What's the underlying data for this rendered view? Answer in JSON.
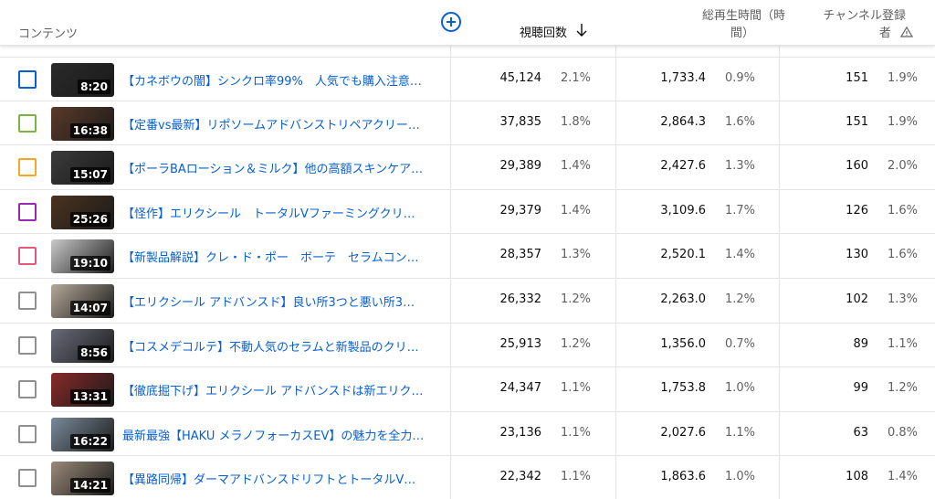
{
  "header": {
    "content_label": "コンテンツ",
    "views_label": "視聴回数",
    "watch_time_line1": "総再生時間（時",
    "watch_time_line2": "間）",
    "subs_line1": "チャンネル登録",
    "subs_line2": "者"
  },
  "colors": {
    "link": "#065fd4",
    "accent": "#065fd4"
  },
  "rows": [
    {
      "checkbox_color": "#065fd4",
      "duration": "8:20",
      "title": "【カネボウの闇】シンクロ率99%　人気でも購入注意…",
      "views": "45,124",
      "views_pct": "2.1%",
      "watch": "1,733.4",
      "watch_pct": "0.9%",
      "subs": "151",
      "subs_pct": "1.9%",
      "thumb_bg": "#2a2a2a"
    },
    {
      "checkbox_color": "#7cb342",
      "duration": "16:38",
      "title": "【定番vs最新】リポソームアドバンストリペアクリー…",
      "views": "37,835",
      "views_pct": "1.8%",
      "watch": "2,864.3",
      "watch_pct": "1.6%",
      "subs": "151",
      "subs_pct": "1.9%",
      "thumb_bg": "#5a3a2a"
    },
    {
      "checkbox_color": "#f5a623",
      "duration": "15:07",
      "title": "【ポーラBAローション＆ミルク】他の高額スキンケア…",
      "views": "29,389",
      "views_pct": "1.4%",
      "watch": "2,427.6",
      "watch_pct": "1.3%",
      "subs": "160",
      "subs_pct": "2.0%",
      "thumb_bg": "#3b3b3b"
    },
    {
      "checkbox_color": "#9c27b0",
      "duration": "25:26",
      "title": "【怪作】エリクシール　トータルVファーミングクリ…",
      "views": "29,379",
      "views_pct": "1.4%",
      "watch": "3,109.6",
      "watch_pct": "1.7%",
      "subs": "126",
      "subs_pct": "1.6%",
      "thumb_bg": "#4a3320"
    },
    {
      "checkbox_color": "#e05a7a",
      "duration": "19:10",
      "title": "【新製品解説】クレ・ド・ポー　ボーテ　セラムコン…",
      "views": "28,357",
      "views_pct": "1.3%",
      "watch": "2,520.1",
      "watch_pct": "1.4%",
      "subs": "130",
      "subs_pct": "1.6%",
      "thumb_bg": "#c9c9c9"
    },
    {
      "checkbox_color": "#909090",
      "duration": "14:07",
      "title": "【エリクシール アドバンスド】良い所3つと悪い所3…",
      "views": "26,332",
      "views_pct": "1.2%",
      "watch": "2,263.0",
      "watch_pct": "1.2%",
      "subs": "102",
      "subs_pct": "1.3%",
      "thumb_bg": "#b5a99a"
    },
    {
      "checkbox_color": "#909090",
      "duration": "8:56",
      "title": "【コスメデコルテ】不動人気のセラムと新製品のクリ…",
      "views": "25,913",
      "views_pct": "1.2%",
      "watch": "1,356.0",
      "watch_pct": "0.7%",
      "subs": "89",
      "subs_pct": "1.1%",
      "thumb_bg": "#6a6a7a"
    },
    {
      "checkbox_color": "#909090",
      "duration": "13:31",
      "title": "【徹底掘下げ】エリクシール アドバンスドは新エリク…",
      "views": "24,347",
      "views_pct": "1.1%",
      "watch": "1,753.8",
      "watch_pct": "1.0%",
      "subs": "99",
      "subs_pct": "1.2%",
      "thumb_bg": "#8a2a2a"
    },
    {
      "checkbox_color": "#909090",
      "duration": "16:22",
      "title": "最新最強【HAKU メラノフォーカスEV】の魅力を全力…",
      "views": "23,136",
      "views_pct": "1.1%",
      "watch": "2,027.6",
      "watch_pct": "1.1%",
      "subs": "63",
      "subs_pct": "0.8%",
      "thumb_bg": "#7a8a9a"
    },
    {
      "checkbox_color": "#909090",
      "duration": "14:21",
      "title": "【異路同帰】ダーマアドバンスドリフトとトータルV…",
      "views": "22,342",
      "views_pct": "1.1%",
      "watch": "1,863.6",
      "watch_pct": "1.0%",
      "subs": "108",
      "subs_pct": "1.4%",
      "thumb_bg": "#9a8a7a"
    }
  ]
}
